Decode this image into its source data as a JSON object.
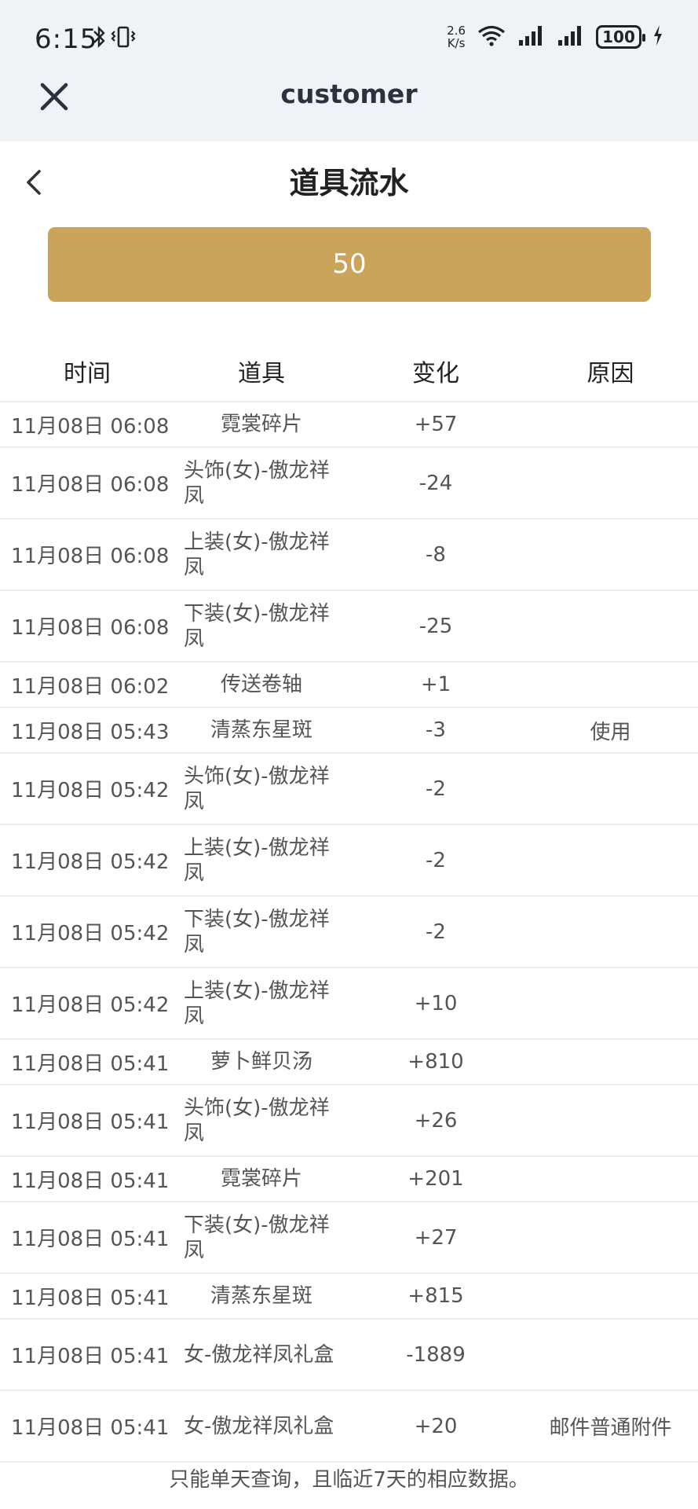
{
  "status_bar": {
    "time": "6:15",
    "net_speed_value": "2.6",
    "net_speed_unit": "K/s",
    "battery": "100",
    "icons": [
      "bluetooth-icon",
      "vibrate-icon",
      "wifi-icon",
      "signal-icon",
      "signal-icon",
      "battery-icon",
      "charging-icon"
    ]
  },
  "appbar": {
    "title": "customer",
    "close_icon": "close-icon"
  },
  "header": {
    "title": "道具流水",
    "back_icon": "chevron-left-icon"
  },
  "gold_bar": {
    "label": "50",
    "color": "#c9a45a"
  },
  "table": {
    "columns": [
      "时间",
      "道具",
      "变化",
      "原因"
    ],
    "rows": [
      {
        "time": "11月08日 06:08",
        "item": "霓裳碎片",
        "change": "+57",
        "reason": ""
      },
      {
        "time": "11月08日 06:08",
        "item": "头饰(女)-傲龙祥凤",
        "change": "-24",
        "reason": ""
      },
      {
        "time": "11月08日 06:08",
        "item": "上装(女)-傲龙祥凤",
        "change": "-8",
        "reason": ""
      },
      {
        "time": "11月08日 06:08",
        "item": "下装(女)-傲龙祥凤",
        "change": "-25",
        "reason": ""
      },
      {
        "time": "11月08日 06:02",
        "item": "传送卷轴",
        "change": "+1",
        "reason": ""
      },
      {
        "time": "11月08日 05:43",
        "item": "清蒸东星斑",
        "change": "-3",
        "reason": "使用"
      },
      {
        "time": "11月08日 05:42",
        "item": "头饰(女)-傲龙祥凤",
        "change": "-2",
        "reason": ""
      },
      {
        "time": "11月08日 05:42",
        "item": "上装(女)-傲龙祥凤",
        "change": "-2",
        "reason": ""
      },
      {
        "time": "11月08日 05:42",
        "item": "下装(女)-傲龙祥凤",
        "change": "-2",
        "reason": ""
      },
      {
        "time": "11月08日 05:42",
        "item": "上装(女)-傲龙祥凤",
        "change": "+10",
        "reason": ""
      },
      {
        "time": "11月08日 05:41",
        "item": "萝卜鲜贝汤",
        "change": "+810",
        "reason": ""
      },
      {
        "time": "11月08日 05:41",
        "item": "头饰(女)-傲龙祥凤",
        "change": "+26",
        "reason": ""
      },
      {
        "time": "11月08日 05:41",
        "item": "霓裳碎片",
        "change": "+201",
        "reason": ""
      },
      {
        "time": "11月08日 05:41",
        "item": "下装(女)-傲龙祥凤",
        "change": "+27",
        "reason": ""
      },
      {
        "time": "11月08日 05:41",
        "item": "清蒸东星斑",
        "change": "+815",
        "reason": ""
      },
      {
        "time": "11月08日 05:41",
        "item": "女-傲龙祥凤礼盒",
        "change": "-1889",
        "reason": ""
      },
      {
        "time": "11月08日 05:41",
        "item": "女-傲龙祥凤礼盒",
        "change": "+20",
        "reason": "邮件普通附件"
      }
    ]
  },
  "footer": {
    "note": "只能单天查询，且临近7天的相应数据。"
  }
}
